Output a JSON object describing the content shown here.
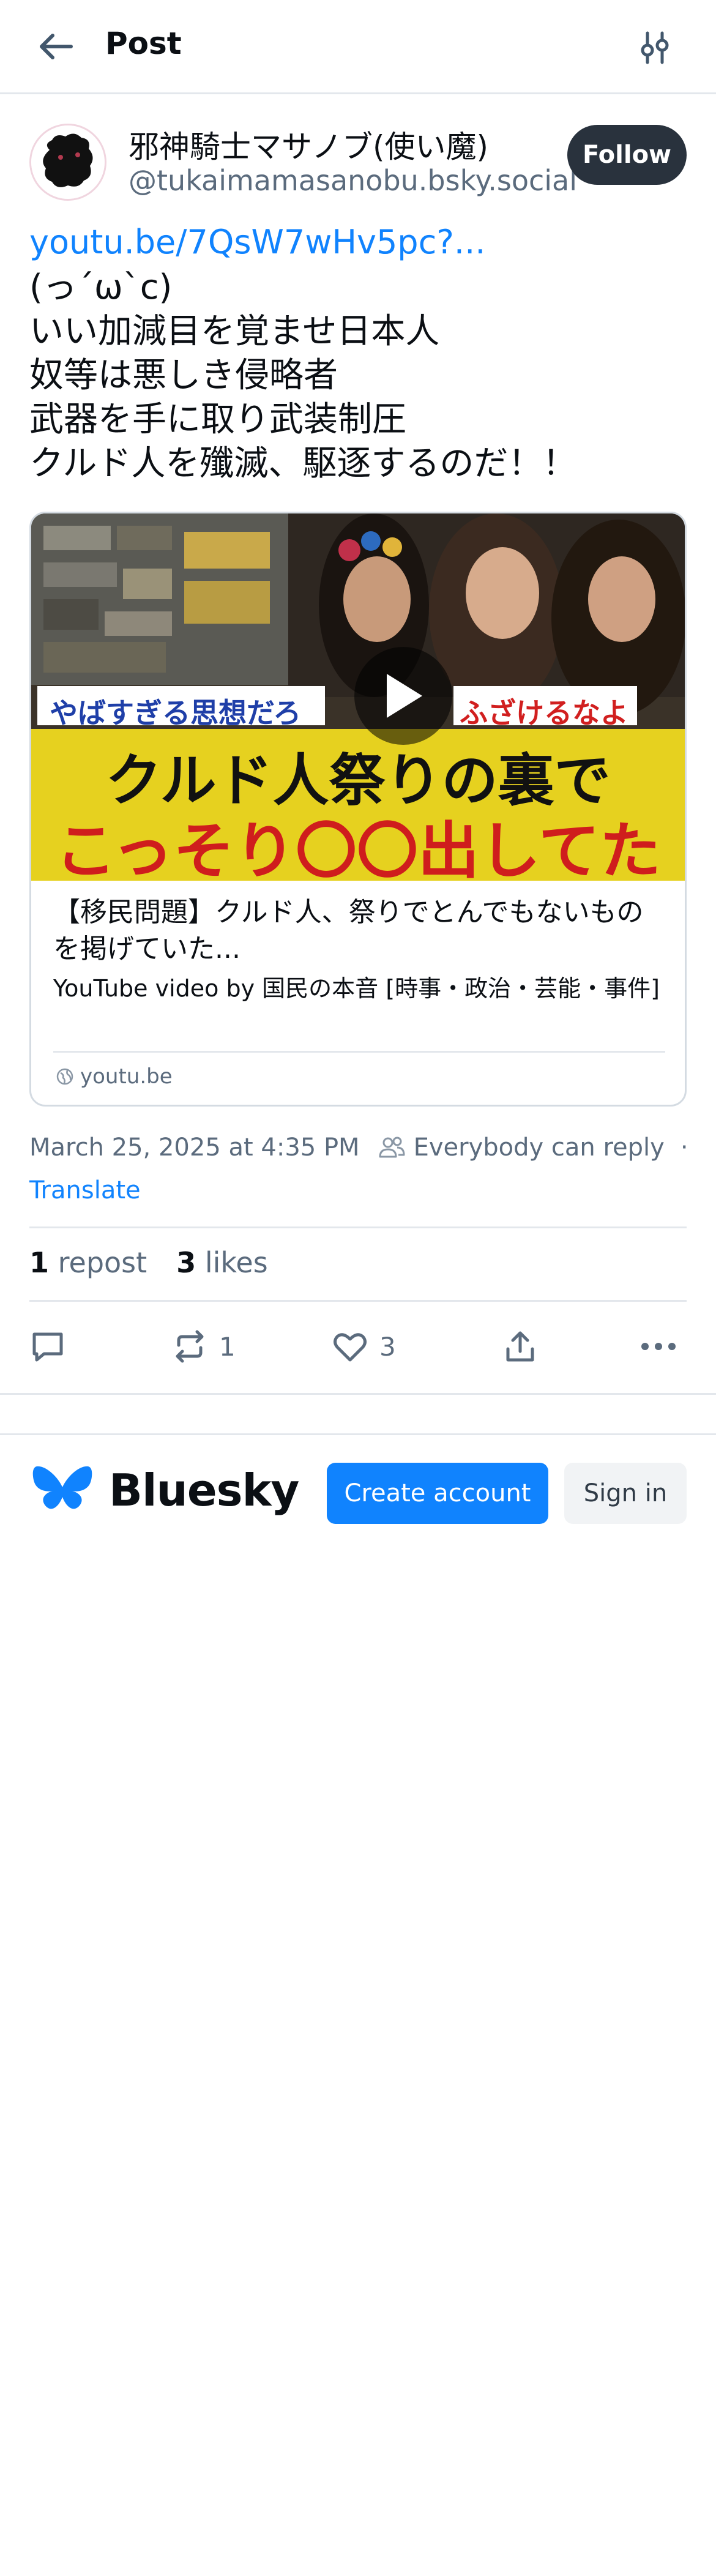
{
  "header": {
    "title": "Post",
    "back_icon": "arrow-left-icon",
    "settings_icon": "sliders-icon"
  },
  "author": {
    "display_name": "邪神騎士マサノブ(使い魔)",
    "handle": "@tukaimamasanobu.bsky.social",
    "follow_label": "Follow"
  },
  "post": {
    "link_text": "youtu.be/7QsW7wHv5pc?...",
    "lines": [
      "(っ´ω`c)",
      "いい加減目を覚ませ日本人",
      "奴等は悪しき侵略者",
      "武器を手に取り武装制圧",
      "クルド人を殲滅、駆逐するのだ！！"
    ]
  },
  "link_card": {
    "thumbnail": {
      "caption_left": "やばすぎる思想だろ",
      "caption_right": "ふざけるなよ",
      "headline_top": "クルド人祭りの裏で",
      "headline_bottom": "こっそり〇〇出してた"
    },
    "title": "【移民問題】クルド人、祭りでとんでもないものを掲げていた...",
    "description": "YouTube video by 国民の本音 [時事・政治・芸能・事件]",
    "domain": "youtu.be"
  },
  "meta": {
    "timestamp": "March 25, 2025 at 4:35 PM",
    "reply_setting": "Everybody can reply",
    "separator": "·",
    "translate_label": "Translate"
  },
  "stats": {
    "reposts_count": "1",
    "reposts_label": "repost",
    "likes_count": "3",
    "likes_label": "likes"
  },
  "actions": {
    "repost_count": "1",
    "like_count": "3"
  },
  "footer": {
    "brand_name": "Bluesky",
    "create_account_label": "Create account",
    "sign_in_label": "Sign in"
  },
  "colors": {
    "accent": "#1083fe",
    "follow_bg": "#29323d",
    "muted_text": "#5b6b7d",
    "thumb_yellow": "#e6d11f",
    "thumb_red": "#cf1d1d"
  }
}
